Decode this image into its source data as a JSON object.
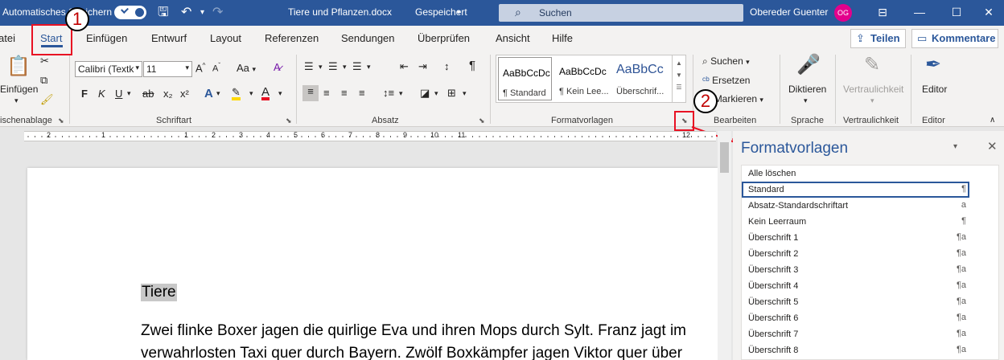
{
  "titlebar": {
    "autosave_label": "Automatisches Speichern",
    "doc_title": "Tiere und Pflanzen.docx",
    "save_state": "Gespeichert",
    "search_placeholder": "Suchen",
    "user_name": "Obereder Guenter",
    "user_initials": "OG"
  },
  "tabs": [
    "atei",
    "Start",
    "Einfügen",
    "Entwurf",
    "Layout",
    "Referenzen",
    "Sendungen",
    "Überprüfen",
    "Ansicht",
    "Hilfe"
  ],
  "header_buttons": {
    "share": "Teilen",
    "comments": "Kommentare"
  },
  "annotations": {
    "step1": "1",
    "step2": "2"
  },
  "ribbon": {
    "clipboard": {
      "paste": "Einfügen",
      "label": "ischenablage"
    },
    "font": {
      "name": "Calibri (Textk",
      "size": "11",
      "grow": "A",
      "shrink": "A",
      "case": "Aa",
      "bold": "F",
      "italic": "K",
      "underline": "U",
      "strike": "ab",
      "subscript": "x₂",
      "superscript": "x²",
      "label": "Schriftart"
    },
    "paragraph": {
      "label": "Absatz"
    },
    "styles": {
      "gallery": [
        {
          "sample": "AaBbCcDc",
          "name": "¶ Standard"
        },
        {
          "sample": "AaBbCcDc",
          "name": "¶ Kein Lee..."
        },
        {
          "sample": "AaBbCc",
          "name": "Überschrif..."
        }
      ],
      "label": "Formatvorlagen"
    },
    "editing": {
      "find": "Suchen",
      "replace": "Ersetzen",
      "select": "Markieren",
      "label": "Bearbeiten"
    },
    "voice": {
      "dictate": "Diktieren",
      "label": "Sprache"
    },
    "sensitivity": {
      "button": "Vertraulichkeit",
      "label": "Vertraulichkeit"
    },
    "editor": {
      "button": "Editor",
      "label": "Editor"
    }
  },
  "ruler_numbers": [
    "2",
    "1",
    "1",
    "2",
    "3",
    "4",
    "5",
    "6",
    "7",
    "8",
    "9",
    "10",
    "11",
    "12"
  ],
  "document": {
    "heading": "Tiere",
    "line1": "Zwei flinke Boxer jagen die quirlige Eva und ihren Mops durch Sylt. Franz jagt im",
    "line2": "verwahrlosten Taxi quer durch Bayern. Zwölf Boxkämpfer jagen Viktor quer über"
  },
  "styles_pane": {
    "title": "Formatvorlagen",
    "items": [
      {
        "name": "Alle löschen",
        "glyph": ""
      },
      {
        "name": "Standard",
        "glyph": "¶"
      },
      {
        "name": "Absatz-Standardschriftart",
        "glyph": "a"
      },
      {
        "name": "Kein Leerraum",
        "glyph": "¶"
      },
      {
        "name": "Überschrift 1",
        "glyph": "¶a"
      },
      {
        "name": "Überschrift 2",
        "glyph": "¶a"
      },
      {
        "name": "Überschrift 3",
        "glyph": "¶a"
      },
      {
        "name": "Überschrift 4",
        "glyph": "¶a"
      },
      {
        "name": "Überschrift 5",
        "glyph": "¶a"
      },
      {
        "name": "Überschrift 6",
        "glyph": "¶a"
      },
      {
        "name": "Überschrift 7",
        "glyph": "¶a"
      },
      {
        "name": "Überschrift 8",
        "glyph": "¶a"
      }
    ]
  },
  "colors": {
    "accent": "#2b579a",
    "annotation": "#e81123",
    "avatar": "#e3008c"
  }
}
